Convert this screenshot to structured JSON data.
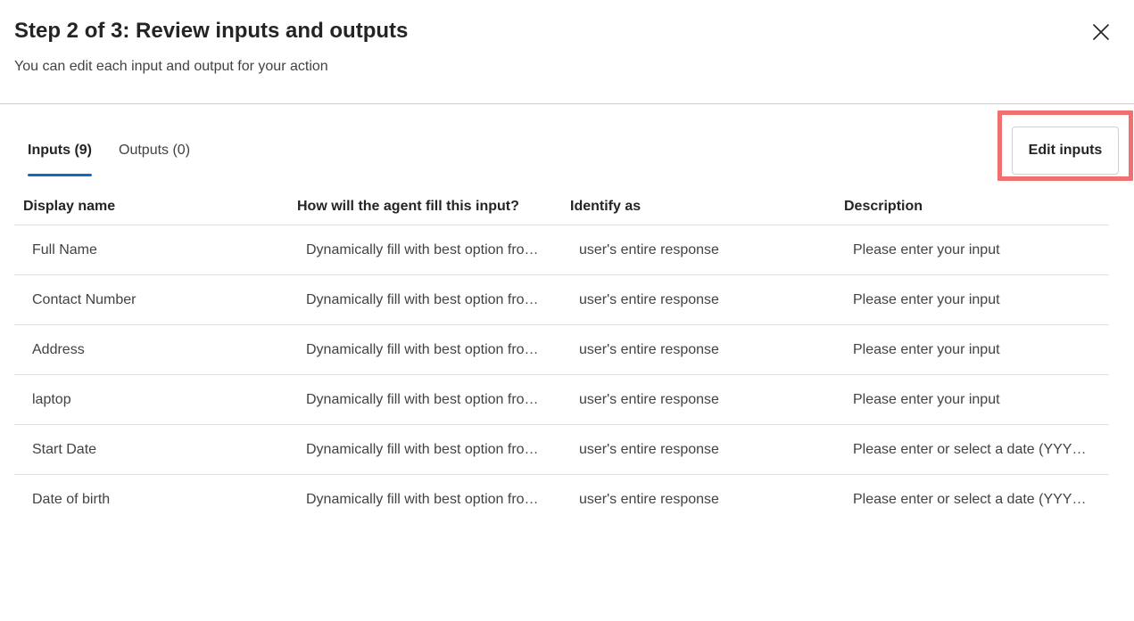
{
  "header": {
    "title": "Step 2 of 3: Review inputs and outputs",
    "subtitle": "You can edit each input and output for your action"
  },
  "tabs": [
    {
      "label": "Inputs (9)",
      "active": true
    },
    {
      "label": "Outputs (0)",
      "active": false
    }
  ],
  "edit_button_label": "Edit inputs",
  "table": {
    "columns": [
      "Display name",
      "How will the agent fill this input?",
      "Identify as",
      "Description"
    ],
    "rows": [
      {
        "name": "Full Name",
        "fill": "Dynamically fill with best option from context",
        "identify": "user's entire response",
        "description": "Please enter your input"
      },
      {
        "name": "Contact Number",
        "fill": "Dynamically fill with best option from context",
        "identify": "user's entire response",
        "description": "Please enter your input"
      },
      {
        "name": "Address",
        "fill": "Dynamically fill with best option from context",
        "identify": "user's entire response",
        "description": "Please enter your input"
      },
      {
        "name": "laptop",
        "fill": "Dynamically fill with best option from context",
        "identify": "user's entire response",
        "description": "Please enter your input"
      },
      {
        "name": "Start Date",
        "fill": "Dynamically fill with best option from context",
        "identify": "user's entire response",
        "description": "Please enter or select a date (YYYY-MM-DD)"
      },
      {
        "name": "Date of birth",
        "fill": "Dynamically fill with best option from context",
        "identify": "user's entire response",
        "description": "Please enter or select a date (YYYY-MM-DD)"
      }
    ]
  },
  "colors": {
    "accent": "#0f6cbd",
    "highlight": "#f07070"
  },
  "icons": {
    "close": "close-icon"
  }
}
